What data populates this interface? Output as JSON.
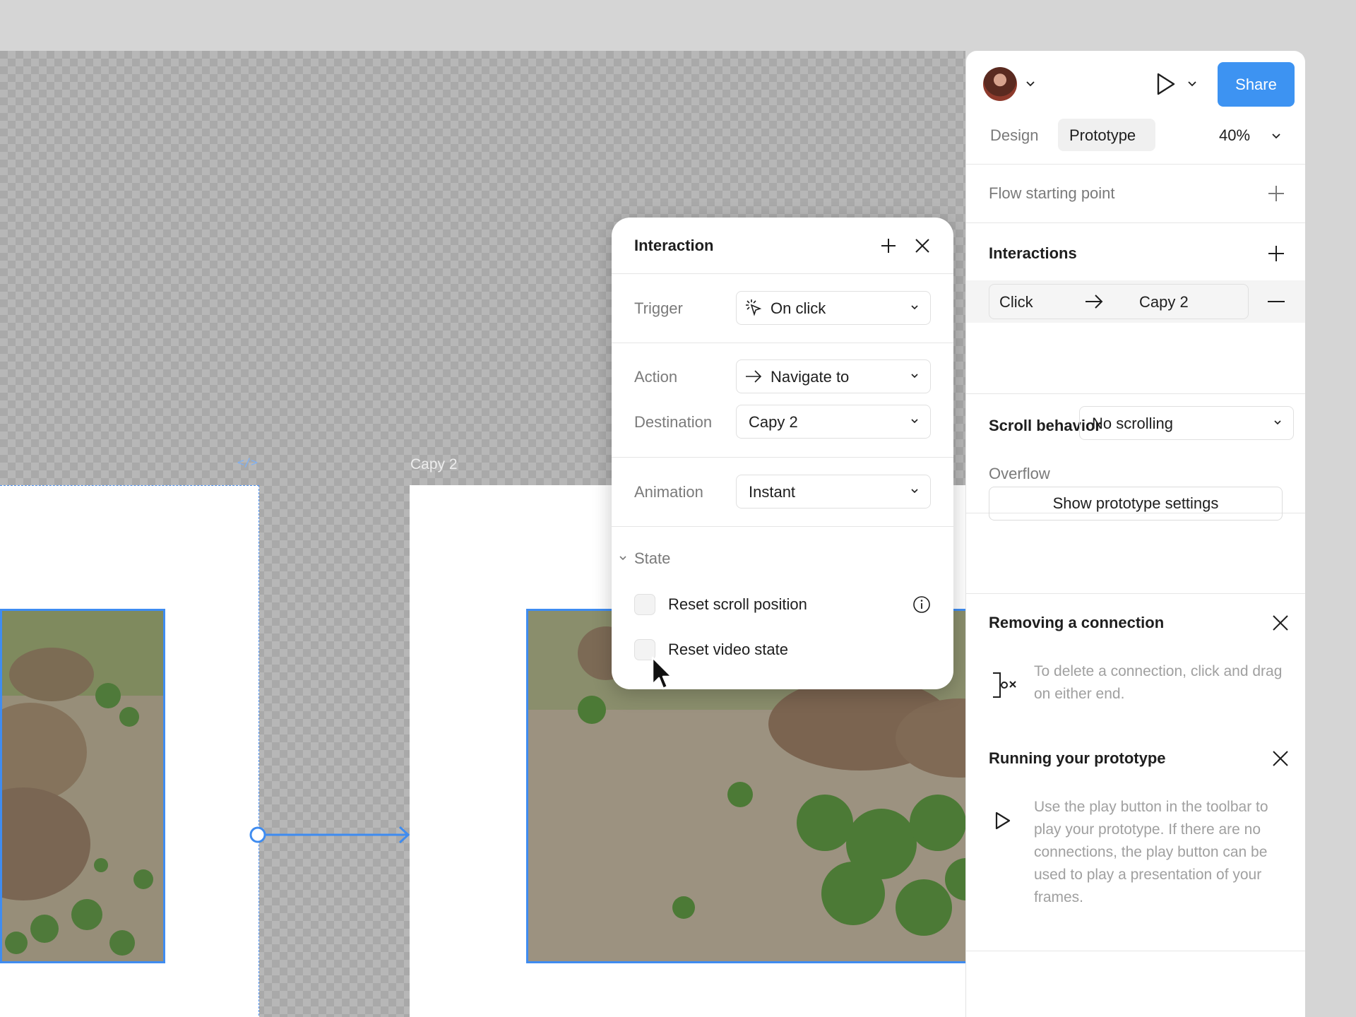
{
  "canvas": {
    "frame_labels": [
      "Capy 2"
    ]
  },
  "interaction_popover": {
    "title": "Interaction",
    "trigger": {
      "label": "Trigger",
      "value": "On click"
    },
    "action": {
      "label": "Action",
      "value": "Navigate to"
    },
    "destination": {
      "label": "Destination",
      "value": "Capy 2"
    },
    "animation": {
      "label": "Animation",
      "value": "Instant"
    },
    "state": {
      "label": "State",
      "options": [
        {
          "label": "Reset scroll position",
          "checked": false
        },
        {
          "label": "Reset video state",
          "checked": false
        }
      ]
    }
  },
  "panel": {
    "share_label": "Share",
    "tabs": [
      {
        "label": "Design",
        "active": false
      },
      {
        "label": "Prototype",
        "active": true
      }
    ],
    "zoom": "40%",
    "flow_starting_point": "Flow starting point",
    "interactions": {
      "title": "Interactions",
      "items": [
        {
          "trigger": "Click",
          "destination": "Capy 2"
        }
      ]
    },
    "scroll_behavior": {
      "title": "Scroll behavior",
      "overflow_label": "Overflow",
      "overflow_value": "No scrolling"
    },
    "show_settings_label": "Show prototype settings",
    "tips": [
      {
        "title": "Removing a connection",
        "text": "To delete a connection, click and drag on either end."
      },
      {
        "title": "Running your prototype",
        "text": "Use the play button in the toolbar to play your prototype. If there are no connections, the play button can be used to play a presentation of your frames."
      }
    ]
  },
  "colors": {
    "accent": "#3d93f2",
    "selection": "#3f8cf0"
  },
  "icons": [
    "plus-icon",
    "close-icon",
    "chevron-down-icon",
    "play-icon",
    "arrow-right-icon",
    "info-icon",
    "minus-icon",
    "click-icon",
    "disconnect-icon",
    "cursor-icon"
  ]
}
